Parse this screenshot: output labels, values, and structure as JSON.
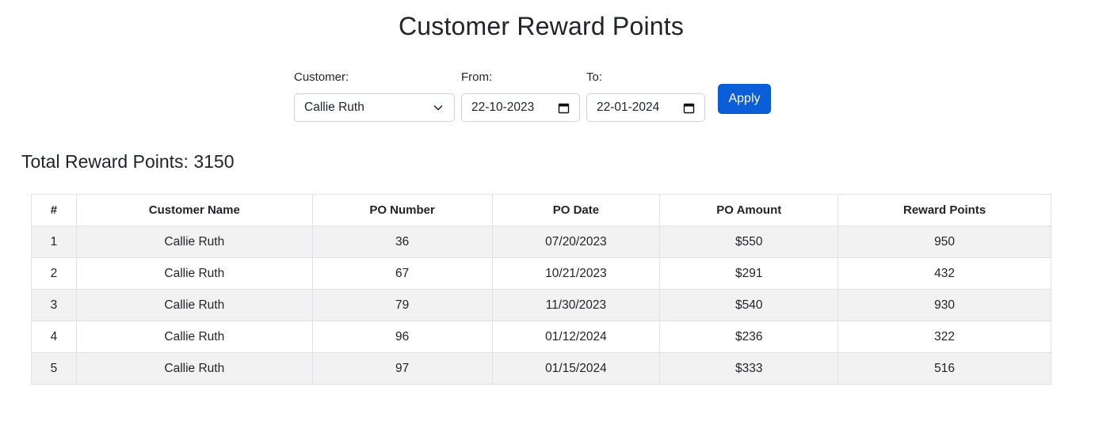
{
  "header": {
    "title": "Customer Reward Points"
  },
  "filters": {
    "customer": {
      "label": "Customer:",
      "value": "Callie Ruth",
      "icon": "chevron-down-icon"
    },
    "from": {
      "label": "From:",
      "value": "22-10-2023",
      "icon": "calendar-icon"
    },
    "to": {
      "label": "To:",
      "value": "22-01-2024",
      "icon": "calendar-icon"
    },
    "apply_label": "Apply"
  },
  "summary": {
    "total_label": "Total Reward Points: 3150"
  },
  "table": {
    "columns": [
      "#",
      "Customer Name",
      "PO Number",
      "PO Date",
      "PO Amount",
      "Reward Points"
    ],
    "rows": [
      [
        "1",
        "Callie Ruth",
        "36",
        "07/20/2023",
        "$550",
        "950"
      ],
      [
        "2",
        "Callie Ruth",
        "67",
        "10/21/2023",
        "$291",
        "432"
      ],
      [
        "3",
        "Callie Ruth",
        "79",
        "11/30/2023",
        "$540",
        "930"
      ],
      [
        "4",
        "Callie Ruth",
        "96",
        "01/12/2024",
        "$236",
        "322"
      ],
      [
        "5",
        "Callie Ruth",
        "97",
        "01/15/2024",
        "$333",
        "516"
      ]
    ]
  },
  "colors": {
    "accent": "#0b5ed7",
    "stripe": "#f2f2f2",
    "border": "#dee2e6"
  }
}
